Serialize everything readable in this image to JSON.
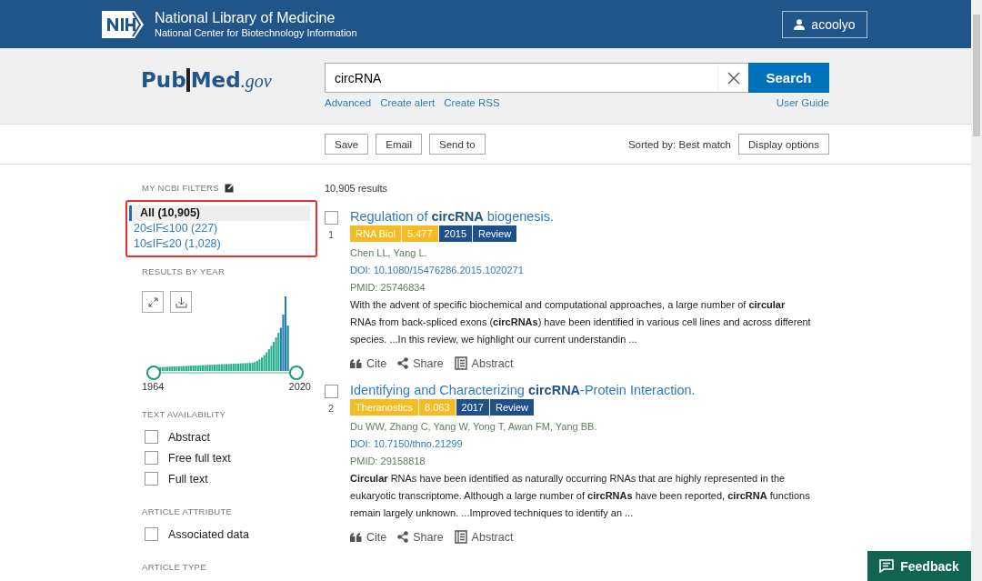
{
  "header": {
    "org_title": "National Library of Medicine",
    "org_subtitle": "National Center for Biotechnology Information",
    "user": "acoolyo"
  },
  "search": {
    "logo_main": "Pub",
    "logo_mid": "Med",
    "logo_suffix": ".gov",
    "value": "circRNA",
    "button": "Search",
    "links": [
      "Advanced",
      "Create alert",
      "Create RSS"
    ],
    "guide": "User Guide"
  },
  "toolbar": {
    "buttons": [
      "Save",
      "Email",
      "Send to"
    ],
    "sorted": "Sorted by: Best match",
    "display": "Display options"
  },
  "sidebar": {
    "filters_heading": "MY NCBI FILTERS",
    "filters": [
      {
        "label": "All (10,905)",
        "selected": true
      },
      {
        "label": "20≤IF≤100 (227)",
        "selected": false
      },
      {
        "label": "10≤IF≤20 (1,028)",
        "selected": false
      }
    ],
    "year_heading": "RESULTS BY YEAR",
    "year_start": "1964",
    "year_end": "2020",
    "year_handles": [
      {
        "level": 0
      },
      {
        "level": 1
      }
    ],
    "sections": [
      {
        "heading": "TEXT AVAILABILITY",
        "options": [
          {
            "label": "Abstract",
            "checked": false
          },
          {
            "label": "Free full text",
            "checked": false
          },
          {
            "label": "Full text",
            "checked": false
          }
        ]
      },
      {
        "heading": "ARTICLE ATTRIBUTE",
        "options": [
          {
            "label": "Associated data",
            "checked": false
          }
        ]
      },
      {
        "heading": "ARTICLE TYPE"
      }
    ]
  },
  "results": {
    "count": "10,905 results",
    "items": [
      {
        "number": "1",
        "checked": false,
        "title": "Regulation of **circRNA** biogenesis.",
        "badges": [
          {
            "text": "RNA Biol",
            "color": "#f5bb22"
          },
          {
            "text": "5.477",
            "color": "#f5bb22"
          },
          {
            "text": "2015",
            "color": "#20508a"
          },
          {
            "text": "Review",
            "color": "#20508a"
          }
        ],
        "authors": "Chen LL, Yang L.",
        "doi": "DOI: 10.1080/15476286.2015.1020271",
        "pmid": "PMID: 25746834",
        "snippet": "With the advent of specific biochemical and computational approaches, a large number of **circular** RNAs from back-spliced exons (**circRNAs**) have been identified in various cell lines and across different species. ...In this review, we highlight our current understandin ...",
        "actions": [
          "Cite",
          "Share",
          "Abstract"
        ]
      },
      {
        "number": "2",
        "checked": false,
        "title": "Identifying and Characterizing **circRNA**-Protein Interaction.",
        "badges": [
          {
            "text": "Theranostics",
            "color": "#f5bb22"
          },
          {
            "text": "8.063",
            "color": "#f5bb22"
          },
          {
            "text": "2017",
            "color": "#20508a"
          },
          {
            "text": "Review",
            "color": "#20508a"
          }
        ],
        "authors": "Du WW, Zhang C, Yang W, Yong T, Awan FM, Yang BB.",
        "doi": "DOI: 10.7150/thno.21299",
        "pmid": "PMID: 29158818",
        "snippet": "**Circular** RNAs have been identified as naturally occurring RNAs that are highly represented in the eukaryotic transcriptome. Although a large number of **circRNAs** have been reported, **circRNA** functions remain largely unknown. ...Improved techniques to identify an ...",
        "actions": [
          "Cite",
          "Share",
          "Abstract"
        ]
      }
    ]
  },
  "feedback": "Feedback"
}
